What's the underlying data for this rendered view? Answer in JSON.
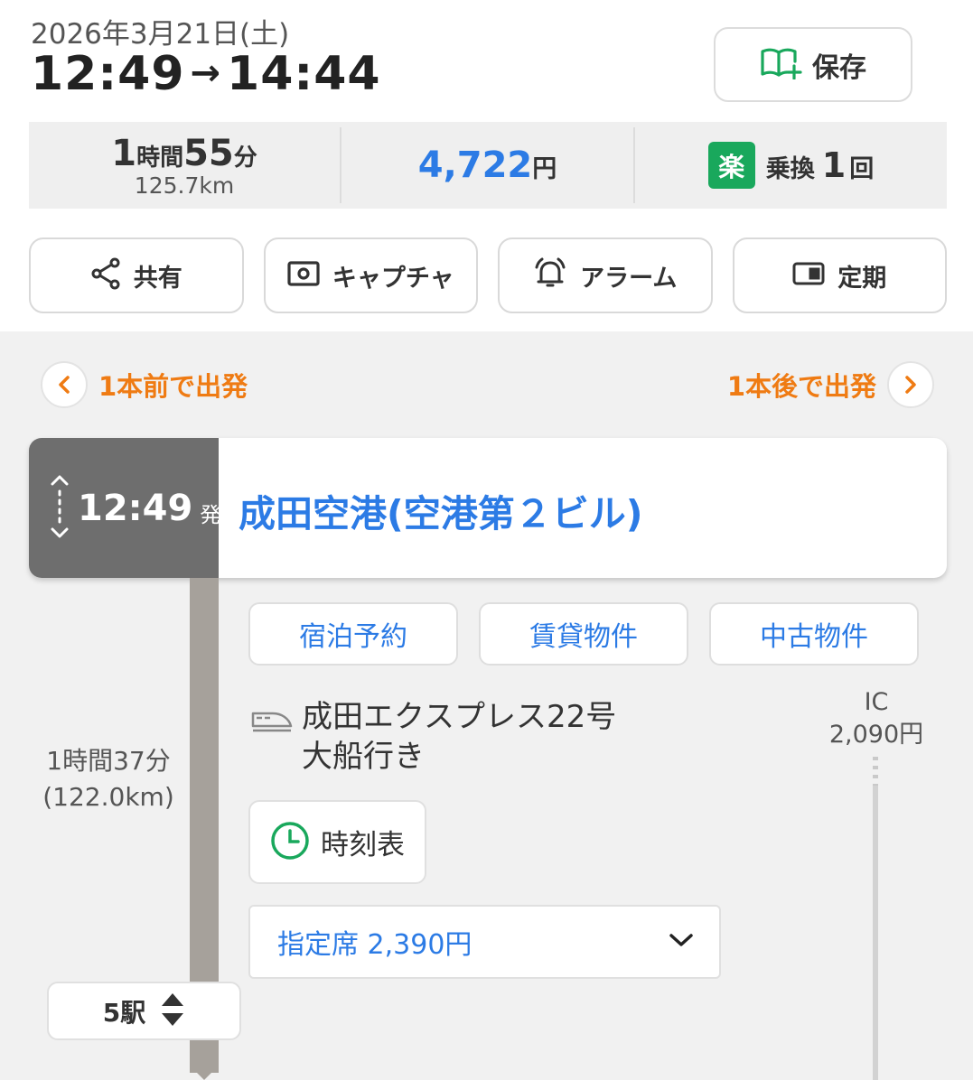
{
  "header": {
    "date": "2026年3月21日(土)",
    "depart_time": "12:49",
    "arrow": "→",
    "arrive_time": "14:44",
    "save_label": "保存"
  },
  "summary": {
    "hours": "1",
    "hours_unit": "時間",
    "minutes": "55",
    "minutes_unit": "分",
    "distance": "125.7km",
    "fare": "4,722",
    "fare_unit": "円",
    "raku_badge": "楽",
    "transfer_label": "乗換",
    "transfer_count": "1",
    "transfer_unit": "回"
  },
  "actions": [
    {
      "label": "共有",
      "icon": "share-icon"
    },
    {
      "label": "キャプチャ",
      "icon": "capture-icon"
    },
    {
      "label": "アラーム",
      "icon": "alarm-icon"
    },
    {
      "label": "定期",
      "icon": "commuter-pass-icon"
    }
  ],
  "nav": {
    "prev_label": "1本前で出発",
    "next_label": "1本後で出発"
  },
  "departure": {
    "time": "12:49",
    "suffix": "発",
    "station": "成田空港(空港第２ビル)"
  },
  "links": [
    "宿泊予約",
    "賃貸物件",
    "中古物件"
  ],
  "segment": {
    "duration": "1時間37分",
    "distance": "(122.0km)",
    "train_line1": "成田エクスプレス22号",
    "train_line2": "大船行き",
    "ic_label": "IC",
    "ic_fare": "2,090円",
    "timetable_label": "時刻表",
    "seat_select": "指定席 2,390円",
    "stations_label": "5駅"
  },
  "colors": {
    "accent_blue": "#2c7be5",
    "accent_orange": "#ef7b13",
    "raku_green": "#19a85c",
    "timeline_gray": "#a6a19b"
  }
}
